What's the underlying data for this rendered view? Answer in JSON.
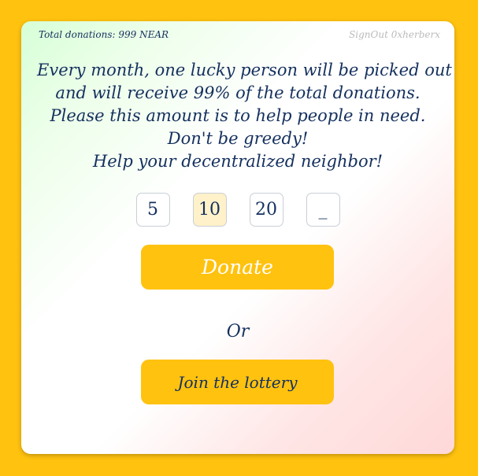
{
  "header": {
    "total_donations": "Total donations: 999 NEAR",
    "signout": "SignOut 0xherberx"
  },
  "intro": {
    "lines": [
      "Every month, one lucky person will be picked out",
      "and will receive 99% of the total donations.",
      "Please this amount is to help people in need.",
      "Don't be greedy!",
      "Help your decentralized neighbor!"
    ]
  },
  "amounts": {
    "options": [
      "5",
      "10",
      "20",
      "_"
    ],
    "selected": "10"
  },
  "donate_label": "Donate",
  "or_label": "Or",
  "lottery_label": "Join the lottery",
  "colors": {
    "background": "#ffc20f",
    "button": "#ffc20f",
    "text": "#14305e",
    "selected_amount": "#fff1c9"
  }
}
